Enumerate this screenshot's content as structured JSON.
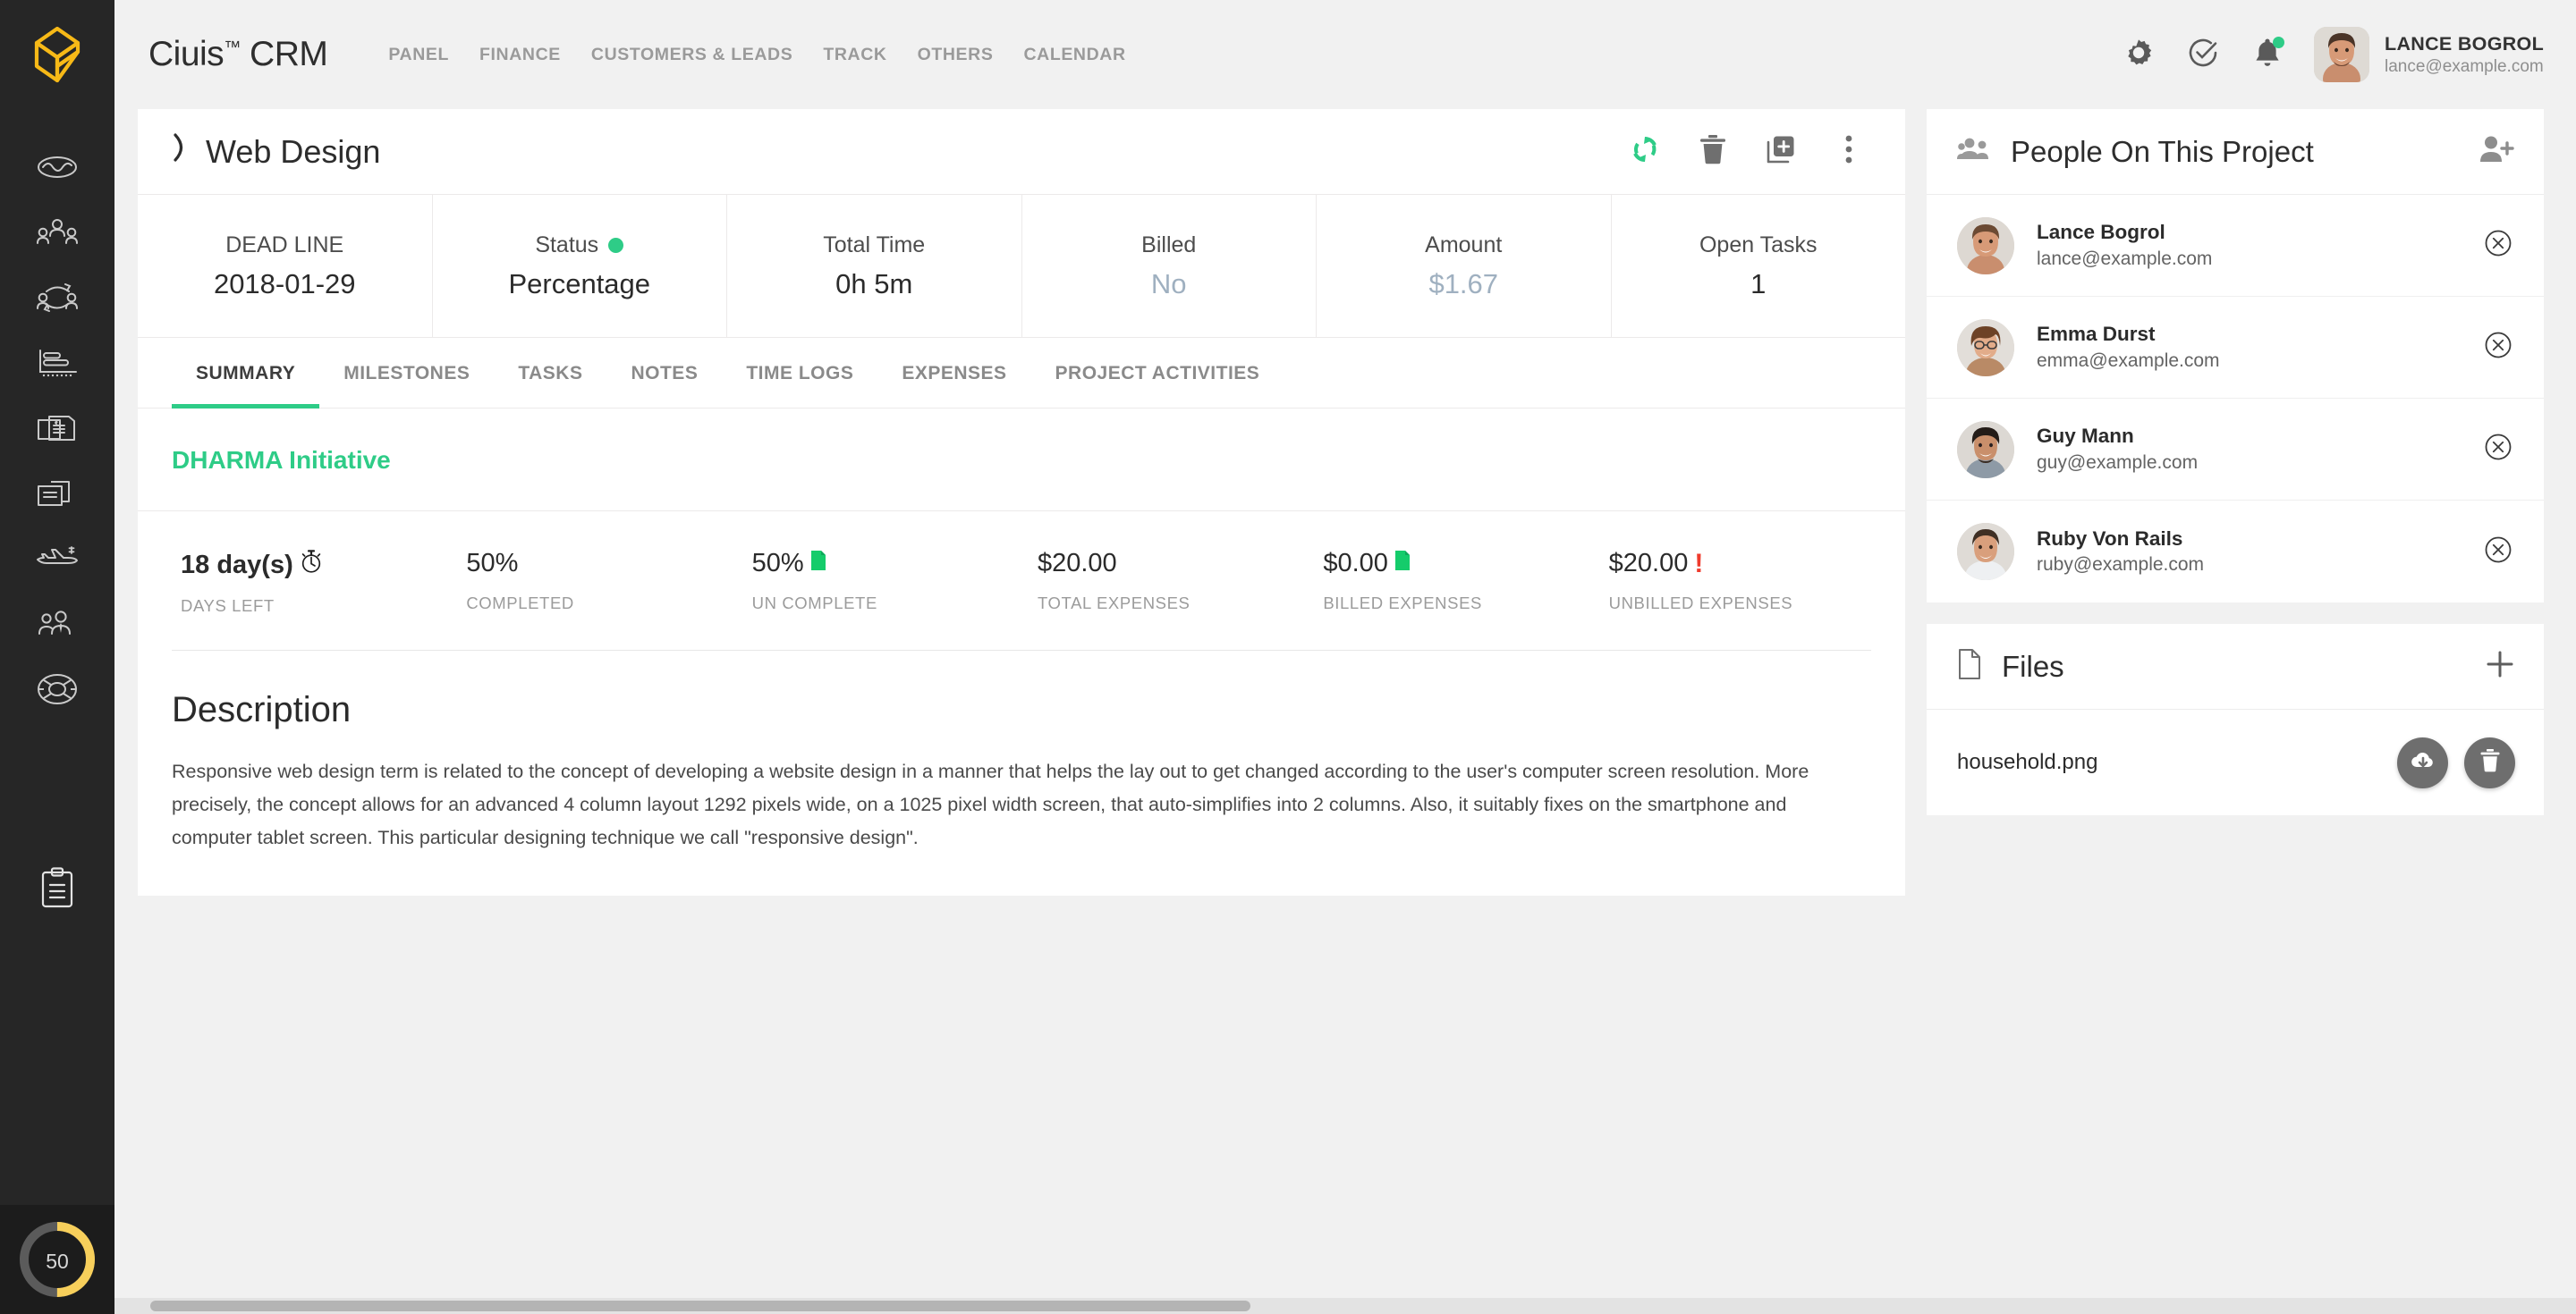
{
  "brand": {
    "name": "Ciuis",
    "tm": "™",
    "suffix": "CRM"
  },
  "topnav": [
    {
      "label": "PANEL"
    },
    {
      "label": "FINANCE"
    },
    {
      "label": "CUSTOMERS & LEADS"
    },
    {
      "label": "TRACK"
    },
    {
      "label": "OTHERS"
    },
    {
      "label": "CALENDAR"
    }
  ],
  "top_right": {
    "settings_icon": "gear-icon",
    "tasks_icon": "check-circle-icon",
    "notifications_icon": "bell-icon",
    "notification_dot_color": "#2ecc87",
    "user_name": "LANCE BOGROL",
    "user_email": "lance@example.com"
  },
  "rail": {
    "logo_icon": "cube-logo-icon",
    "logo_color": "#f7b917",
    "items": [
      {
        "icon": "dashboard-wave-icon"
      },
      {
        "icon": "team-group-icon"
      },
      {
        "icon": "customer-exchange-icon"
      },
      {
        "icon": "bar-chart-icon"
      },
      {
        "icon": "invoice-dollar-icon"
      },
      {
        "icon": "documents-icon"
      },
      {
        "icon": "travel-expense-icon"
      },
      {
        "icon": "leads-people-icon"
      },
      {
        "icon": "support-lifebuoy-icon"
      },
      {
        "icon": "clipboard-icon"
      }
    ],
    "gauge_value": "50",
    "gauge_color": "#f7cf5b"
  },
  "project": {
    "title": "Web Design",
    "status_icon": "moon-phase-icon",
    "actions": [
      {
        "name": "refresh-button",
        "icon": "refresh-icon",
        "color": "#2ecc87"
      },
      {
        "name": "delete-button",
        "icon": "trash-icon",
        "color": "#6f6f6f"
      },
      {
        "name": "duplicate-button",
        "icon": "add-card-icon",
        "color": "#6f6f6f"
      },
      {
        "name": "more-button",
        "icon": "more-vertical-icon",
        "color": "#6f6f6f"
      }
    ],
    "stats": [
      {
        "label": "DEAD LINE",
        "value": "2018-01-29",
        "muted": false,
        "dot": false
      },
      {
        "label": "Status",
        "value": "Percentage",
        "muted": false,
        "dot": true
      },
      {
        "label": "Total Time",
        "value": "0h 5m",
        "muted": false,
        "dot": false
      },
      {
        "label": "Billed",
        "value": "No",
        "muted": true,
        "dot": false
      },
      {
        "label": "Amount",
        "value": "$1.67",
        "muted": true,
        "dot": false
      },
      {
        "label": "Open Tasks",
        "value": "1",
        "muted": false,
        "dot": false
      }
    ],
    "tabs": [
      {
        "label": "SUMMARY",
        "active": true
      },
      {
        "label": "MILESTONES",
        "active": false
      },
      {
        "label": "TASKS",
        "active": false
      },
      {
        "label": "NOTES",
        "active": false
      },
      {
        "label": "TIME LOGS",
        "active": false
      },
      {
        "label": "EXPENSES",
        "active": false
      },
      {
        "label": "PROJECT ACTIVITIES",
        "active": false
      }
    ],
    "initiative": "DHARMA Initiative",
    "metrics": [
      {
        "value": "18 day(s)",
        "caption": "DAYS LEFT",
        "icon": "stopwatch-icon",
        "bold": true
      },
      {
        "value": "50%",
        "caption": "COMPLETED",
        "icon": "",
        "bold": false
      },
      {
        "value": "50%",
        "caption": "UN COMPLETE",
        "icon": "green-doc-icon",
        "bold": false
      },
      {
        "value": "$20.00",
        "caption": "TOTAL EXPENSES",
        "icon": "",
        "bold": false
      },
      {
        "value": "$0.00",
        "caption": "BILLED EXPENSES",
        "icon": "green-doc-icon",
        "bold": false
      },
      {
        "value": "$20.00",
        "caption": "UNBILLED EXPENSES",
        "icon": "red-exclamation-icon",
        "bold": false
      }
    ],
    "description_title": "Description",
    "description_body": "Responsive web design term is related to the concept of developing a website design in a manner that helps the lay out to get changed according to the user's computer screen resolution. More precisely, the concept allows for an advanced 4 column layout 1292 pixels wide, on a 1025 pixel width screen, that auto-simplifies into 2 columns. Also, it suitably fixes on the smartphone and computer tablet screen. This particular designing technique we call \"responsive design\"."
  },
  "people_panel": {
    "title": "People On This Project",
    "header_icon": "people-group-icon",
    "add_icon": "add-person-icon",
    "people": [
      {
        "name": "Lance Bogrol",
        "email": "lance@example.com",
        "remove_icon": "remove-circle-icon"
      },
      {
        "name": "Emma Durst",
        "email": "emma@example.com",
        "remove_icon": "remove-circle-icon"
      },
      {
        "name": "Guy Mann",
        "email": "guy@example.com",
        "remove_icon": "remove-circle-icon"
      },
      {
        "name": "Ruby Von Rails",
        "email": "ruby@example.com",
        "remove_icon": "remove-circle-icon"
      }
    ]
  },
  "files_panel": {
    "title": "Files",
    "header_icon": "file-icon",
    "add_icon": "plus-icon",
    "files": [
      {
        "name": "household.png",
        "download_icon": "cloud-download-icon",
        "delete_icon": "trash-icon"
      }
    ]
  }
}
